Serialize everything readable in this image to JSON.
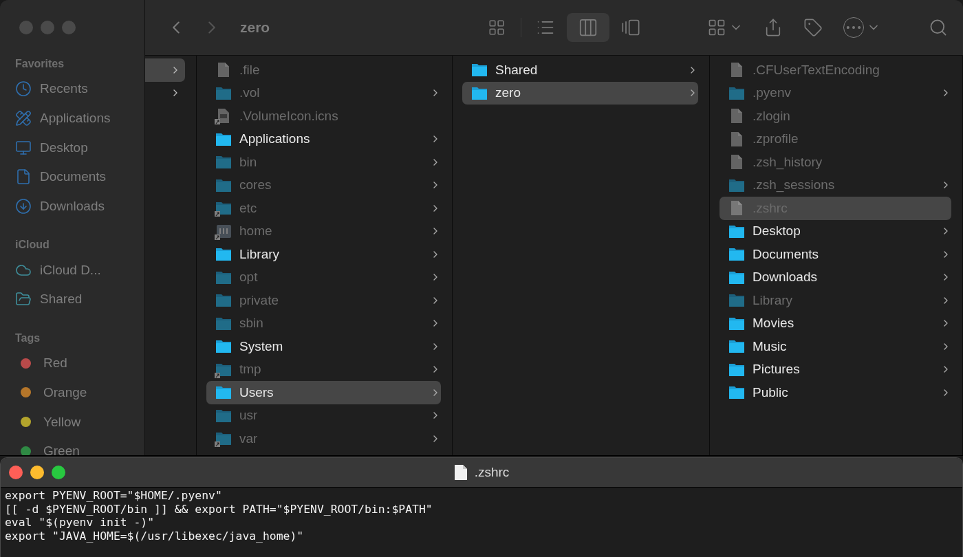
{
  "finder": {
    "title": "zero",
    "views": [
      {
        "kind": "icons",
        "selected": false
      },
      {
        "kind": "list",
        "selected": false
      },
      {
        "kind": "columns",
        "selected": true
      },
      {
        "kind": "gallery",
        "selected": false
      }
    ],
    "sidebar": [
      {
        "title": "Favorites",
        "items": [
          {
            "kind": "recents",
            "label": "Recents"
          },
          {
            "kind": "applications",
            "label": "Applications"
          },
          {
            "kind": "desktop",
            "label": "Desktop"
          },
          {
            "kind": "documents",
            "label": "Documents"
          },
          {
            "kind": "downloads",
            "label": "Downloads"
          }
        ]
      },
      {
        "title": "iCloud",
        "items": [
          {
            "kind": "cloud",
            "label": "iCloud D..."
          },
          {
            "kind": "shared",
            "label": "Shared"
          }
        ]
      },
      {
        "title": "Tags",
        "items": [
          {
            "kind": "tag",
            "label": "Red",
            "color": "#b94a4a"
          },
          {
            "kind": "tag",
            "label": "Orange",
            "color": "#b5762a"
          },
          {
            "kind": "tag",
            "label": "Yellow",
            "color": "#b3a42c"
          },
          {
            "kind": "tag",
            "label": "Green",
            "color": "#2f8a44"
          }
        ]
      }
    ],
    "first_column": [
      {
        "selected": true
      },
      {
        "selected": false
      }
    ],
    "columns": [
      [
        {
          "kind": "file",
          "label": ".file",
          "hidden": true,
          "alias": false,
          "selected": false,
          "chevron": false
        },
        {
          "kind": "folder",
          "label": ".vol",
          "hidden": true,
          "alias": false,
          "selected": false,
          "chevron": true
        },
        {
          "kind": "image",
          "label": ".VolumeIcon.icns",
          "hidden": true,
          "alias": true,
          "selected": false,
          "chevron": false
        },
        {
          "kind": "folder",
          "label": "Applications",
          "hidden": false,
          "alias": false,
          "selected": false,
          "chevron": true
        },
        {
          "kind": "folder",
          "label": "bin",
          "hidden": true,
          "alias": false,
          "selected": false,
          "chevron": true
        },
        {
          "kind": "folder",
          "label": "cores",
          "hidden": true,
          "alias": false,
          "selected": false,
          "chevron": true
        },
        {
          "kind": "folder",
          "label": "etc",
          "hidden": true,
          "alias": true,
          "selected": false,
          "chevron": true
        },
        {
          "kind": "disk",
          "label": "home",
          "hidden": true,
          "alias": true,
          "selected": false,
          "chevron": true
        },
        {
          "kind": "folder",
          "label": "Library",
          "hidden": false,
          "alias": false,
          "selected": false,
          "chevron": true
        },
        {
          "kind": "folder",
          "label": "opt",
          "hidden": true,
          "alias": false,
          "selected": false,
          "chevron": true
        },
        {
          "kind": "folder",
          "label": "private",
          "hidden": true,
          "alias": false,
          "selected": false,
          "chevron": true
        },
        {
          "kind": "folder",
          "label": "sbin",
          "hidden": true,
          "alias": false,
          "selected": false,
          "chevron": true
        },
        {
          "kind": "folder",
          "label": "System",
          "hidden": false,
          "alias": false,
          "selected": false,
          "chevron": true
        },
        {
          "kind": "folder",
          "label": "tmp",
          "hidden": true,
          "alias": true,
          "selected": false,
          "chevron": true
        },
        {
          "kind": "folder",
          "label": "Users",
          "hidden": false,
          "alias": false,
          "selected": true,
          "chevron": true
        },
        {
          "kind": "folder",
          "label": "usr",
          "hidden": true,
          "alias": false,
          "selected": false,
          "chevron": true
        },
        {
          "kind": "folder",
          "label": "var",
          "hidden": true,
          "alias": true,
          "selected": false,
          "chevron": true
        }
      ],
      [
        {
          "kind": "folder",
          "label": "Shared",
          "hidden": false,
          "alias": false,
          "selected": false,
          "chevron": true
        },
        {
          "kind": "folder",
          "label": "zero",
          "hidden": false,
          "alias": false,
          "selected": true,
          "chevron": true
        }
      ],
      [
        {
          "kind": "file",
          "label": ".CFUserTextEncoding",
          "hidden": true,
          "alias": false,
          "selected": false,
          "chevron": false
        },
        {
          "kind": "folder",
          "label": ".pyenv",
          "hidden": true,
          "alias": false,
          "selected": false,
          "chevron": true
        },
        {
          "kind": "file",
          "label": ".zlogin",
          "hidden": true,
          "alias": false,
          "selected": false,
          "chevron": false
        },
        {
          "kind": "file",
          "label": ".zprofile",
          "hidden": true,
          "alias": false,
          "selected": false,
          "chevron": false
        },
        {
          "kind": "file",
          "label": ".zsh_history",
          "hidden": true,
          "alias": false,
          "selected": false,
          "chevron": false
        },
        {
          "kind": "folder",
          "label": ".zsh_sessions",
          "hidden": true,
          "alias": false,
          "selected": false,
          "chevron": true
        },
        {
          "kind": "file",
          "label": ".zshrc",
          "hidden": true,
          "alias": false,
          "selected": true,
          "chevron": false
        },
        {
          "kind": "folder",
          "label": "Desktop",
          "hidden": false,
          "alias": false,
          "selected": false,
          "chevron": true
        },
        {
          "kind": "folder",
          "label": "Documents",
          "hidden": false,
          "alias": false,
          "selected": false,
          "chevron": true
        },
        {
          "kind": "folder",
          "label": "Downloads",
          "hidden": false,
          "alias": false,
          "selected": false,
          "chevron": true
        },
        {
          "kind": "folder",
          "label": "Library",
          "hidden": true,
          "alias": false,
          "selected": false,
          "chevron": true
        },
        {
          "kind": "folder",
          "label": "Movies",
          "hidden": false,
          "alias": false,
          "selected": false,
          "chevron": true
        },
        {
          "kind": "folder",
          "label": "Music",
          "hidden": false,
          "alias": false,
          "selected": false,
          "chevron": true
        },
        {
          "kind": "folder",
          "label": "Pictures",
          "hidden": false,
          "alias": false,
          "selected": false,
          "chevron": true
        },
        {
          "kind": "folder",
          "label": "Public",
          "hidden": false,
          "alias": false,
          "selected": false,
          "chevron": true
        }
      ]
    ]
  },
  "editor": {
    "title": ".zshrc",
    "lines": [
      "export PYENV_ROOT=\"$HOME/.pyenv\"",
      "[[ -d $PYENV_ROOT/bin ]] && export PATH=\"$PYENV_ROOT/bin:$PATH\"",
      "eval \"$(pyenv init -)\"",
      "export \"JAVA_HOME=$(/usr/libexec/java_home)\""
    ]
  }
}
